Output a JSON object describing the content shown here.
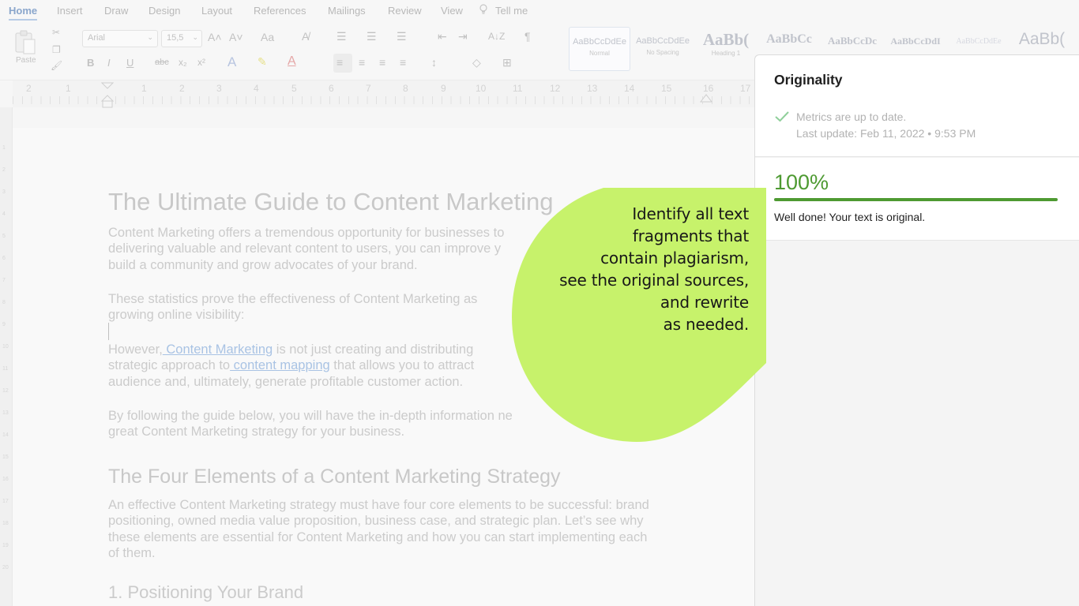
{
  "ribbon_tabs": [
    "Home",
    "Insert",
    "Draw",
    "Design",
    "Layout",
    "References",
    "Mailings",
    "Review",
    "View"
  ],
  "tell_me": "Tell me",
  "ribbon": {
    "paste_label": "Paste",
    "font_name": "Arial",
    "font_size": "15,5",
    "grow_font": "A˄",
    "shrink_font": "A˅",
    "change_case": "Aa",
    "bold": "B",
    "italic": "I",
    "underline": "U",
    "strikethrough": "abc",
    "subscript": "x₂",
    "superscript": "x²",
    "sort": "A↓Z",
    "pilcrow": "¶",
    "styles": [
      {
        "sample": "AaBbCcDdEe",
        "name": "Normal"
      },
      {
        "sample": "AaBbCcDdEe",
        "name": "No Spacing"
      },
      {
        "sample": "AaBb(",
        "name": "Heading 1"
      },
      {
        "sample": "AaBbCc",
        "name": ""
      },
      {
        "sample": "AaBbCcDc",
        "name": ""
      },
      {
        "sample": "AaBbCcDdI",
        "name": ""
      },
      {
        "sample": "AaBbCcDdEe",
        "name": ""
      },
      {
        "sample": "AaBb(",
        "name": ""
      }
    ]
  },
  "ruler_numbers": [
    "2",
    "1",
    "1",
    "2",
    "3",
    "4",
    "5",
    "6",
    "7",
    "8",
    "9",
    "10",
    "11",
    "12",
    "13",
    "14",
    "15",
    "16",
    "17"
  ],
  "vruler_numbers": [
    "1",
    "2",
    "3",
    "4",
    "5",
    "6",
    "7",
    "8",
    "9",
    "10",
    "11",
    "12",
    "13",
    "14",
    "15",
    "16",
    "17",
    "18",
    "19",
    "20"
  ],
  "document": {
    "title": "The Ultimate Guide to Content Marketing",
    "p1": [
      "Content Marketing offers a tremendous opportunity for businesses to",
      "delivering valuable and relevant content to users, you can improve y",
      "build a community and grow advocates of your brand."
    ],
    "p2": [
      "These statistics prove the effectiveness of Content Marketing as",
      "growing online visibility:"
    ],
    "p3_a": "However,",
    "p3_link1": " Content Marketing",
    "p3_b": " is not just creating and distributing",
    "p3_c": "strategic approach to",
    "p3_link2": " content mapping",
    "p3_d": " that allows you to attract",
    "p3_e": "audience and, ultimately, generate profitable customer action.",
    "p4": [
      "By following the guide below, you will have the in-depth information ne",
      "great Content Marketing strategy for your business."
    ],
    "h2": "The Four Elements of a Content Marketing Strategy",
    "p5": [
      "An effective Content Marketing strategy must have four core elements to be successful: brand",
      "positioning, owned media value proposition, business case, and strategic plan. Let’s see why",
      "these elements are essential for Content Marketing and how you can start implementing each",
      "of them."
    ],
    "h3": "1. Positioning Your Brand"
  },
  "panel": {
    "title": "Originality",
    "status": "Metrics are up to date.",
    "last_update": "Last update: Feb 11, 2022 • 9:53 PM",
    "score_text": "100%",
    "score_value": 1.0,
    "message": "Well done! Your text is original."
  },
  "callout": {
    "lines": [
      "Identify all text",
      "fragments that",
      "contain plagiarism,",
      "see the original sources,",
      "and rewrite",
      "as needed."
    ],
    "bubble_color": "#c7f26b"
  },
  "colors": {
    "accent_green": "#4e9a32",
    "bubble": "#c7f26b"
  }
}
